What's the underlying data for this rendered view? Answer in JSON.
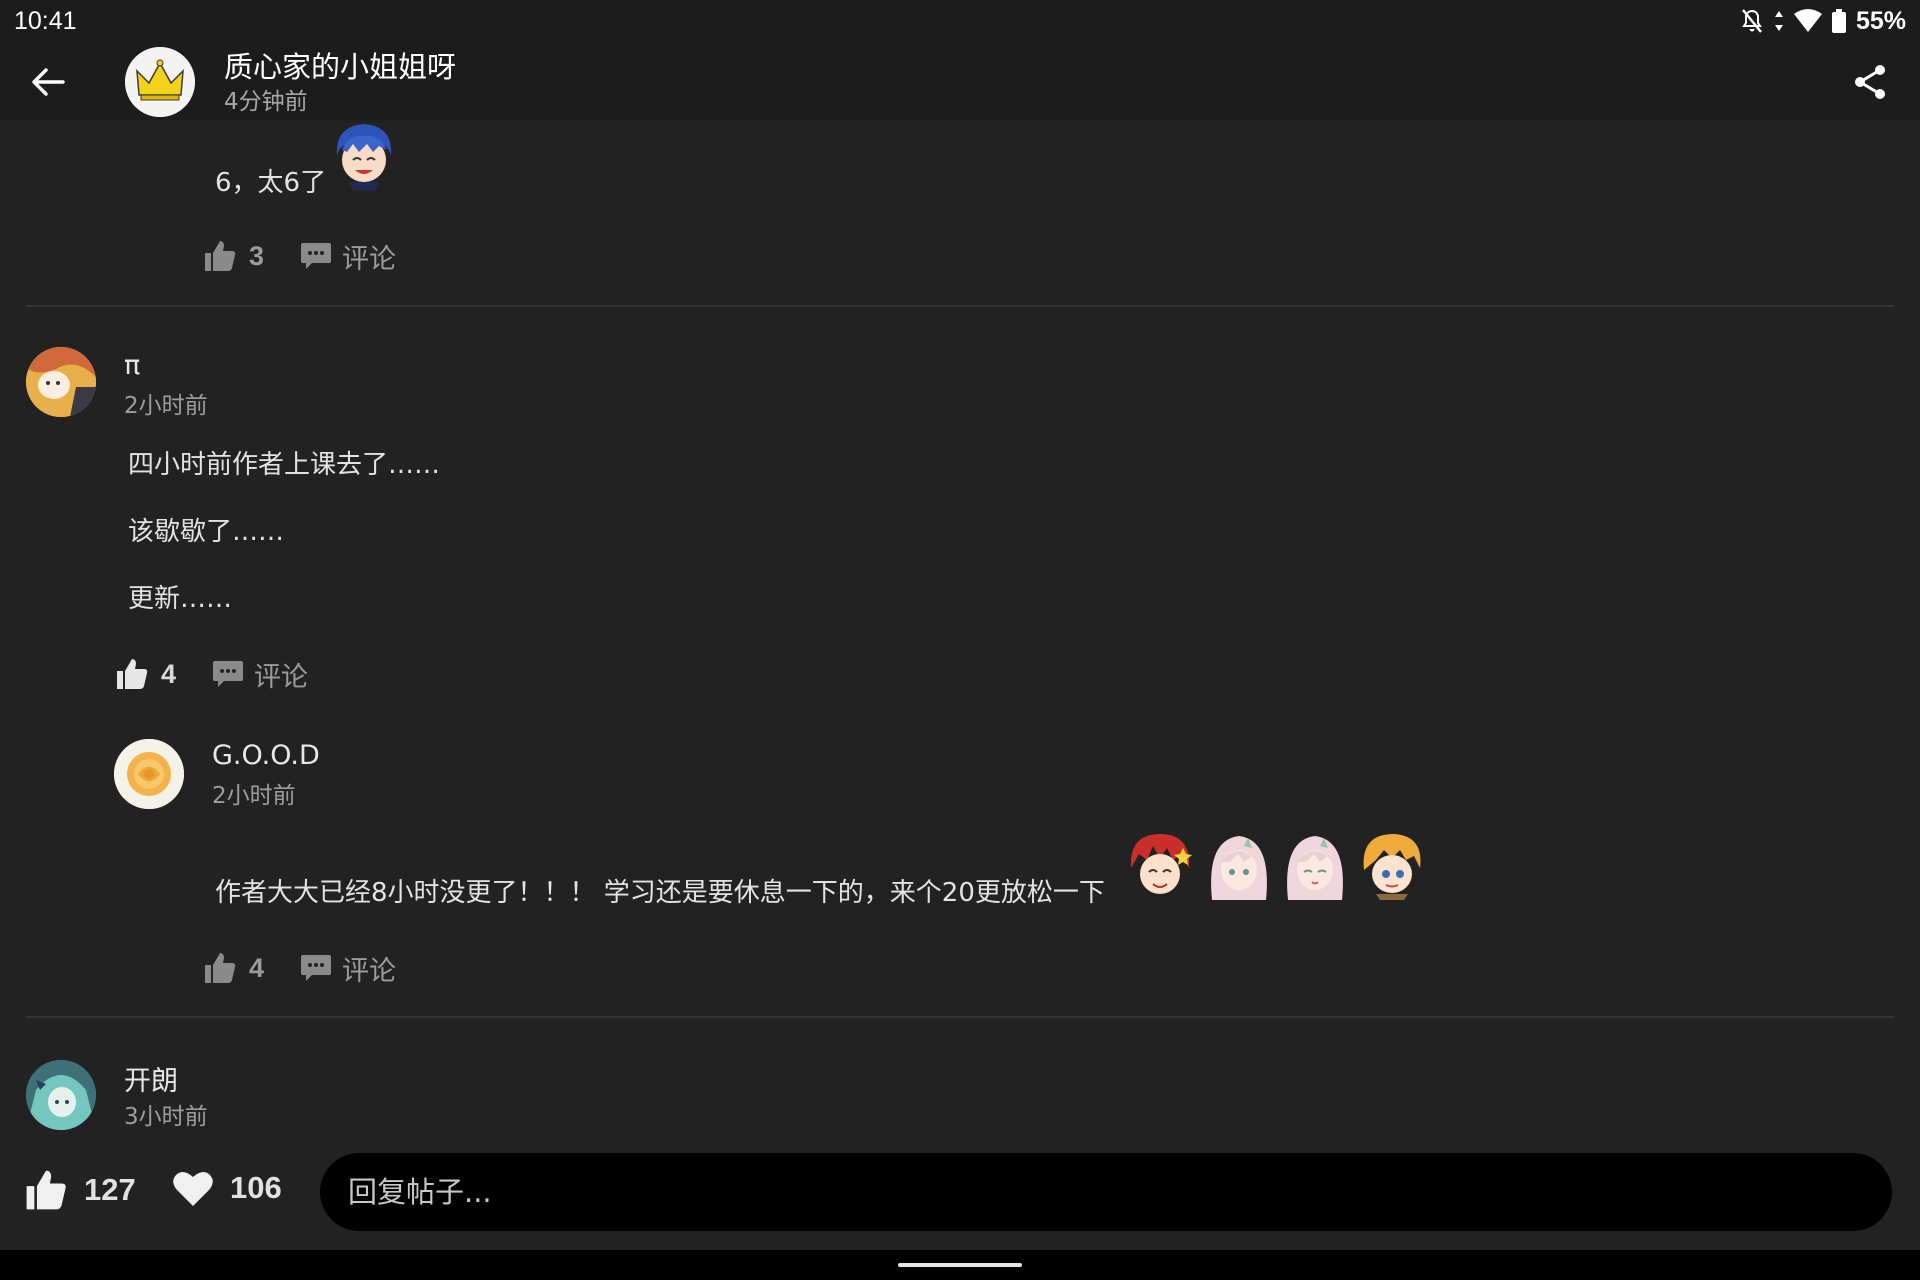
{
  "status_bar": {
    "time": "10:41",
    "battery": "55%"
  },
  "header": {
    "author_name": "质心家的小姐姐呀",
    "post_time": "4分钟前"
  },
  "comments": [
    {
      "body": [
        "6，太6了"
      ],
      "likes": "3",
      "comment_label": "评论"
    },
    {
      "username": "π",
      "time": "2小时前",
      "body": [
        "四小时前作者上课去了……",
        "该歇歇了……",
        "更新……"
      ],
      "likes": "4",
      "comment_label": "评论",
      "reply": {
        "username": "G.O.O.D",
        "time": "2小时前",
        "body": [
          "作者大大已经8小时没更了！！！ 学习还是要休息一下的，来个20更放松一下"
        ],
        "likes": "4",
        "comment_label": "评论"
      }
    },
    {
      "username": "开朗",
      "time": "3小时前"
    }
  ],
  "bottom_bar": {
    "like_count": "127",
    "favorite_count": "106",
    "reply_placeholder": "回复帖子..."
  },
  "colors": {
    "background": "#222222",
    "bar": "#1c1c1c",
    "input": "#000000",
    "muted": "#9b9b9b"
  },
  "icons": [
    "back-arrow-icon",
    "share-icon",
    "thumbs-up-icon",
    "comment-bubble-icon",
    "heart-icon",
    "bell-off-icon",
    "wifi-icon",
    "battery-icon"
  ]
}
